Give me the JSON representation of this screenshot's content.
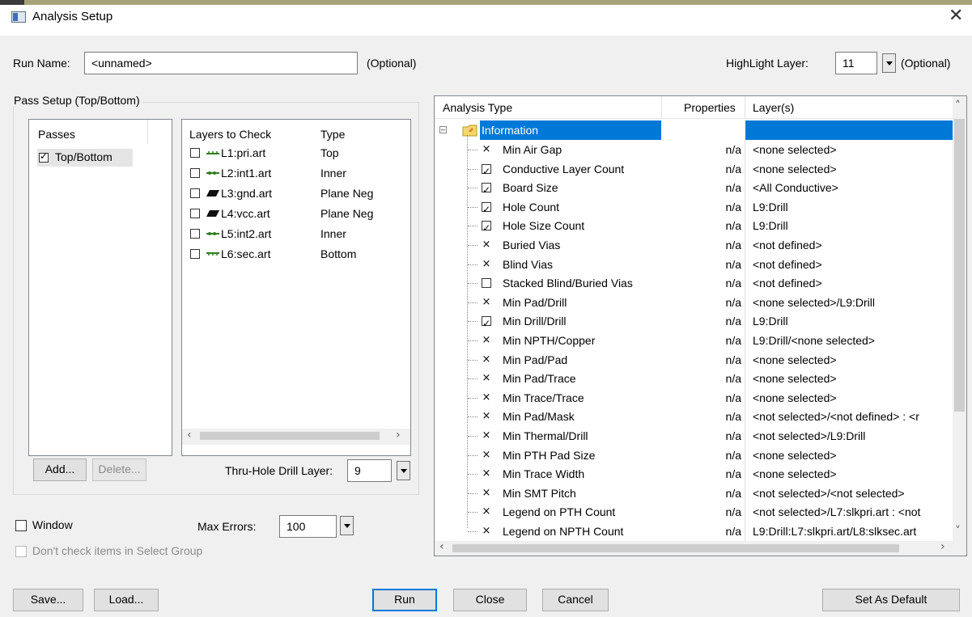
{
  "window": {
    "title": "Analysis Setup",
    "close_icon": "close-icon"
  },
  "run_name": {
    "label": "Run Name:",
    "value": "<unnamed>",
    "optional": "(Optional)"
  },
  "highlight": {
    "label": "HighLight Layer:",
    "value": "11",
    "optional": "(Optional)"
  },
  "pass_setup": {
    "title": "Pass Setup (Top/Bottom)",
    "passes_header": "Passes",
    "passes": [
      {
        "label": "Top/Bottom",
        "checked": true
      }
    ],
    "layers_header": "Layers to Check",
    "type_header": "Type",
    "layers": [
      {
        "name": "L1:pri.art",
        "type": "Top",
        "icon": "top-layer-icon",
        "checked": false
      },
      {
        "name": "L2:int1.art",
        "type": "Inner",
        "icon": "inner-layer-icon",
        "checked": false
      },
      {
        "name": "L3:gnd.art",
        "type": "Plane Neg",
        "icon": "plane-layer-icon",
        "checked": false
      },
      {
        "name": "L4:vcc.art",
        "type": "Plane Neg",
        "icon": "plane-layer-icon",
        "checked": false
      },
      {
        "name": "L5:int2.art",
        "type": "Inner",
        "icon": "inner-layer-icon",
        "checked": false
      },
      {
        "name": "L6:sec.art",
        "type": "Bottom",
        "icon": "bottom-layer-icon",
        "checked": false
      }
    ],
    "add_label": "Add...",
    "delete_label": "Delete...",
    "drill_label": "Thru-Hole Drill Layer:",
    "drill_value": "9"
  },
  "window_check": {
    "label": "Window",
    "checked": false
  },
  "max_errors": {
    "label": "Max Errors:",
    "value": "100"
  },
  "select_group": {
    "label": "Don't check items in Select Group",
    "checked": false
  },
  "analysis": {
    "headers": {
      "type": "Analysis Type",
      "properties": "Properties",
      "layers": "Layer(s)"
    },
    "root": {
      "label": "Information",
      "icon": "folder-icon"
    },
    "items": [
      {
        "name": "Min Air Gap",
        "state": "x",
        "properties": "n/a",
        "layers": "<none selected>"
      },
      {
        "name": "Conductive Layer Count",
        "state": "checked",
        "properties": "n/a",
        "layers": "<none selected>"
      },
      {
        "name": "Board Size",
        "state": "checked",
        "properties": "n/a",
        "layers": "<All Conductive>"
      },
      {
        "name": "Hole Count",
        "state": "checked",
        "properties": "n/a",
        "layers": "L9:Drill"
      },
      {
        "name": "Hole Size Count",
        "state": "checked",
        "properties": "n/a",
        "layers": "L9:Drill"
      },
      {
        "name": "Buried Vias",
        "state": "x",
        "properties": "n/a",
        "layers": "<not defined>"
      },
      {
        "name": "Blind Vias",
        "state": "x",
        "properties": "n/a",
        "layers": "<not defined>"
      },
      {
        "name": "Stacked Blind/Buried Vias",
        "state": "unchecked",
        "properties": "n/a",
        "layers": "<not defined>"
      },
      {
        "name": "Min Pad/Drill",
        "state": "x",
        "properties": "n/a",
        "layers": "<none selected>/L9:Drill"
      },
      {
        "name": "Min Drill/Drill",
        "state": "checked",
        "properties": "n/a",
        "layers": "L9:Drill"
      },
      {
        "name": "Min NPTH/Copper",
        "state": "x",
        "properties": "n/a",
        "layers": "L9:Drill/<none selected>"
      },
      {
        "name": "Min Pad/Pad",
        "state": "x",
        "properties": "n/a",
        "layers": "<none selected>"
      },
      {
        "name": "Min Pad/Trace",
        "state": "x",
        "properties": "n/a",
        "layers": "<none selected>"
      },
      {
        "name": "Min Trace/Trace",
        "state": "x",
        "properties": "n/a",
        "layers": "<none selected>"
      },
      {
        "name": "Min Pad/Mask",
        "state": "x",
        "properties": "n/a",
        "layers": "<not selected>/<not defined> : <r"
      },
      {
        "name": "Min Thermal/Drill",
        "state": "x",
        "properties": "n/a",
        "layers": "<not selected>/L9:Drill"
      },
      {
        "name": "Min PTH Pad Size",
        "state": "x",
        "properties": "n/a",
        "layers": "<none selected>"
      },
      {
        "name": "Min Trace Width",
        "state": "x",
        "properties": "n/a",
        "layers": "<none selected>"
      },
      {
        "name": "Min SMT Pitch",
        "state": "x",
        "properties": "n/a",
        "layers": "<not selected>/<not selected>"
      },
      {
        "name": "Legend on PTH Count",
        "state": "x",
        "properties": "n/a",
        "layers": "<not selected>/L7:slkpri.art : <not"
      },
      {
        "name": "Legend on NPTH Count",
        "state": "x",
        "properties": "n/a",
        "layers": "L9:Drill:L7:slkpri.art/L8:slksec.art"
      }
    ]
  },
  "buttons": {
    "save": "Save...",
    "load": "Load...",
    "run": "Run",
    "close": "Close",
    "cancel": "Cancel",
    "default": "Set As Default"
  },
  "colors": {
    "selection": "#0078d7",
    "background": "#f0f0f0"
  }
}
